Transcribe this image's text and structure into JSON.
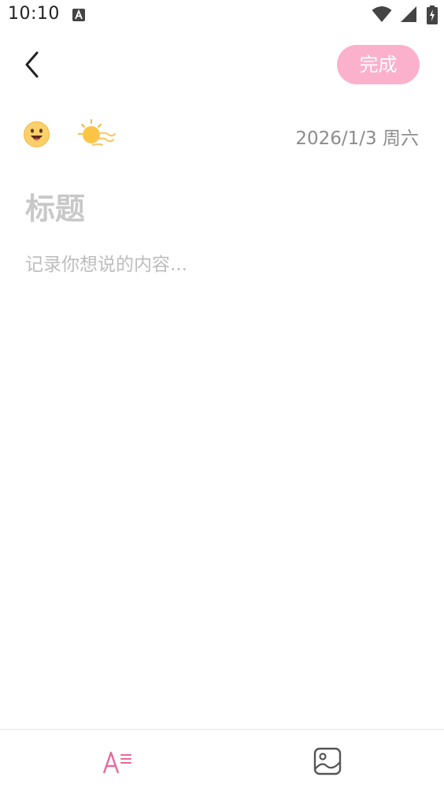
{
  "status_bar": {
    "time": "10:10",
    "icons": [
      "a-notification-icon",
      "wifi-icon",
      "signal-icon",
      "battery-icon"
    ]
  },
  "header": {
    "back_icon": "chevron-left-icon",
    "done_label": "完成",
    "done_color": "#fbb0cc"
  },
  "meta": {
    "mood_icon": "smiling-face-icon",
    "weather_icon": "sunny-windy-icon",
    "date": "2026/1/3 周六"
  },
  "editor": {
    "title_placeholder": "标题",
    "content_placeholder": "记录你想说的内容..."
  },
  "toolbar": {
    "text_format_icon": "text-format-icon",
    "image_icon": "image-icon",
    "accent_color": "#e8679a"
  }
}
